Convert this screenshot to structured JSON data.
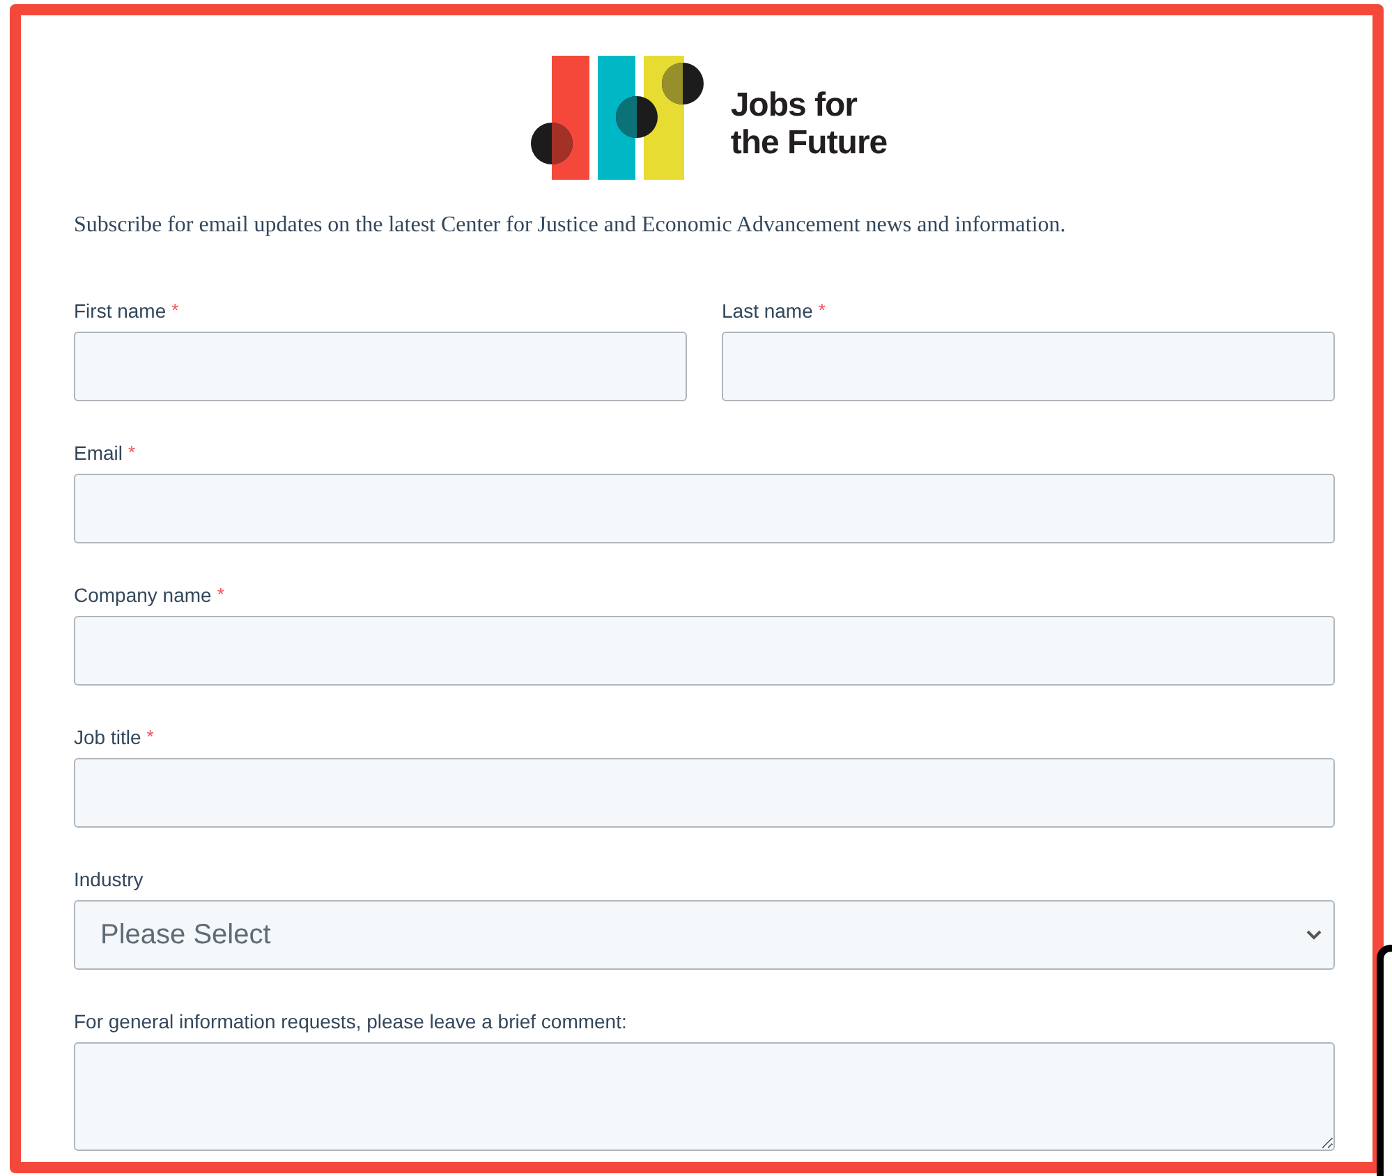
{
  "logo": {
    "lines": [
      "Jobs for",
      "the Future"
    ]
  },
  "intro": "Subscribe for email updates on the latest Center for Justice and Economic Advancement news and information.",
  "rows": [
    [
      {
        "label": "First name",
        "required_mark": "*",
        "kind": "text"
      },
      {
        "label": "Last name",
        "required_mark": "*",
        "kind": "text"
      }
    ],
    [
      {
        "label": "Email",
        "required_mark": "*",
        "kind": "text"
      }
    ],
    [
      {
        "label": "Company name",
        "required_mark": "*",
        "kind": "text"
      }
    ],
    [
      {
        "label": "Job title",
        "required_mark": "*",
        "kind": "text"
      }
    ],
    [
      {
        "label": "Industry",
        "kind": "select",
        "placeholder": "Please Select"
      }
    ],
    [
      {
        "label": "For general information requests, please leave a brief comment:",
        "kind": "textarea"
      }
    ]
  ]
}
